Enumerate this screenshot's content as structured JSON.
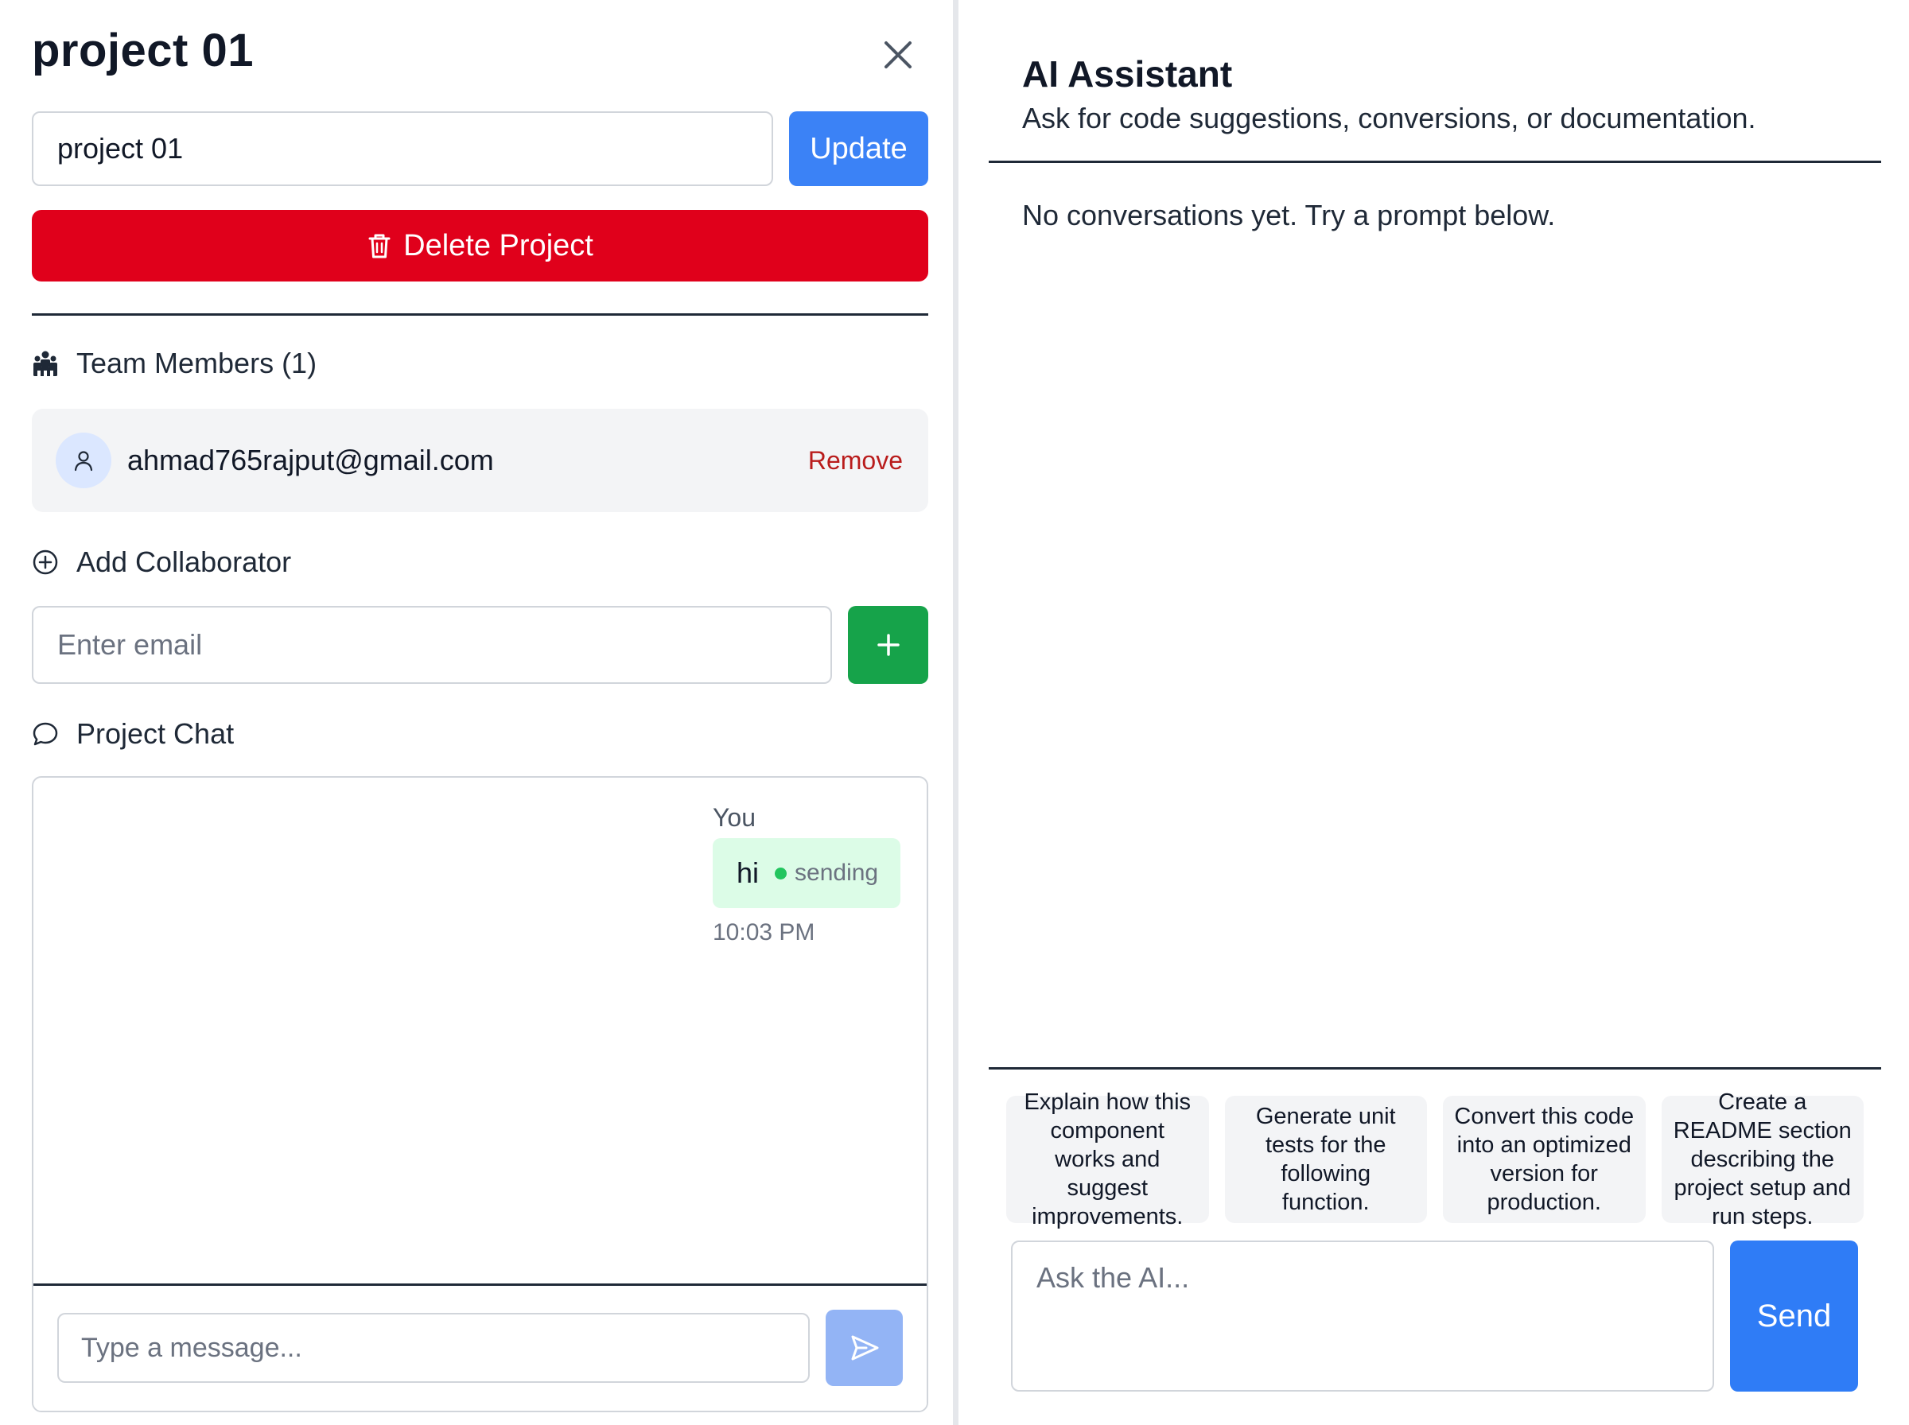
{
  "project": {
    "title": "project 01",
    "name_value": "project 01",
    "update_label": "Update",
    "delete_label": "Delete Project"
  },
  "team": {
    "header": "Team Members (1)",
    "members": [
      {
        "email": "ahmad765rajput@gmail.com",
        "remove_label": "Remove"
      }
    ]
  },
  "collaborator": {
    "header": "Add Collaborator",
    "email_placeholder": "Enter email"
  },
  "chat": {
    "header": "Project Chat",
    "messages": [
      {
        "sender": "You",
        "text": "hi",
        "status": "sending",
        "time": "10:03 PM"
      }
    ],
    "input_placeholder": "Type a message..."
  },
  "ai": {
    "title": "AI Assistant",
    "subtitle": "Ask for code suggestions, conversions, or documentation.",
    "empty_text": "No conversations yet. Try a prompt below.",
    "prompts": [
      "Explain how this component works and suggest improvements.",
      "Generate unit tests for the following function.",
      "Convert this code into an optimized version for production.",
      "Create a README section describing the project setup and run steps."
    ],
    "input_placeholder": "Ask the AI...",
    "send_label": "Send"
  },
  "icons": {
    "close": "close-icon",
    "delete": "trash-icon",
    "team": "team-icon",
    "member": "user-icon",
    "collaborator": "plus-circle-icon",
    "add": "plus-icon",
    "chat": "chat-bubble-icon",
    "send": "send-icon"
  },
  "colors": {
    "primary": "#3b82f6",
    "danger": "#e0001b",
    "success": "#16a34a",
    "sent_bubble": "#dcfce7",
    "status_dot": "#22c55e",
    "remove_text": "#b91c1c"
  }
}
